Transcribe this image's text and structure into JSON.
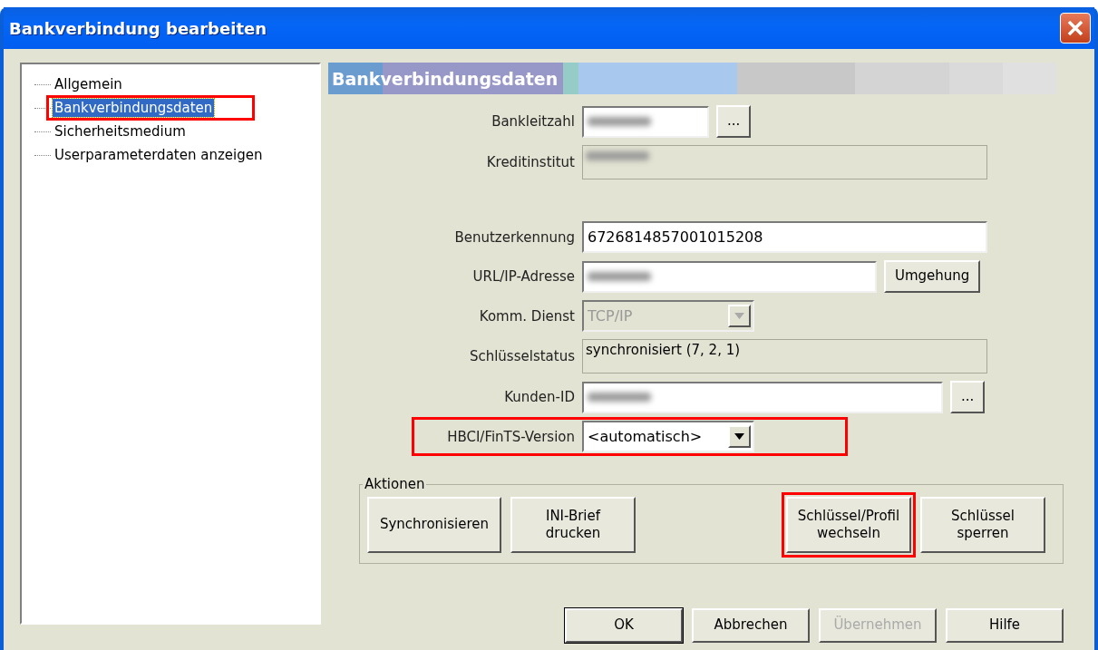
{
  "window": {
    "title": "Bankverbindung bearbeiten"
  },
  "tree": {
    "items": [
      {
        "label": "Allgemein",
        "selected": false,
        "highlighted": false
      },
      {
        "label": "Bankverbindungsdaten",
        "selected": true,
        "highlighted": true
      },
      {
        "label": "Sicherheitsmedium",
        "selected": false,
        "highlighted": false
      },
      {
        "label": "Userparameterdaten anzeigen",
        "selected": false,
        "highlighted": false
      }
    ]
  },
  "section": {
    "title": "Bankverbindungsdaten"
  },
  "fields": [
    {
      "label": "Bankleitzahl",
      "kind": "input",
      "redacted": true,
      "button": "...",
      "highlighted": false
    },
    {
      "label": "Kreditinstitut",
      "kind": "static",
      "redacted": true,
      "highlighted": false
    },
    {
      "label": "Benutzerkennung",
      "kind": "input",
      "value": "6726814857001015208",
      "highlighted": false
    },
    {
      "label": "URL/IP-Adresse",
      "kind": "input",
      "redacted": true,
      "button": "Umgehung",
      "highlighted": false
    },
    {
      "label": "Komm. Dienst",
      "kind": "select",
      "value": "TCP/IP",
      "disabled": true,
      "highlighted": false
    },
    {
      "label": "Schlüsselstatus",
      "kind": "static",
      "value": "synchronisiert (7, 2, 1)",
      "highlighted": false
    },
    {
      "label": "Kunden-ID",
      "kind": "input",
      "redacted": true,
      "button": "...",
      "highlighted": false
    },
    {
      "label": "HBCI/FinTS-Version",
      "kind": "select",
      "value": "<automatisch>",
      "disabled": false,
      "highlighted": true
    }
  ],
  "actions": {
    "title": "Aktionen",
    "buttons": [
      {
        "lines": [
          "Synchronisieren"
        ],
        "highlighted": false
      },
      {
        "lines": [
          "INI-Brief",
          "drucken"
        ],
        "highlighted": false
      },
      {
        "lines": [
          "Schlüssel/Profil",
          "wechseln"
        ],
        "highlighted": true
      },
      {
        "lines": [
          "Schlüssel",
          "sperren"
        ],
        "highlighted": false
      }
    ]
  },
  "footer_buttons": [
    {
      "label": "OK",
      "default": true,
      "disabled": false
    },
    {
      "label": "Abbrechen",
      "default": false,
      "disabled": false
    },
    {
      "label": "Übernehmen",
      "default": false,
      "disabled": true
    },
    {
      "label": "Hilfe",
      "default": false,
      "disabled": false
    }
  ]
}
